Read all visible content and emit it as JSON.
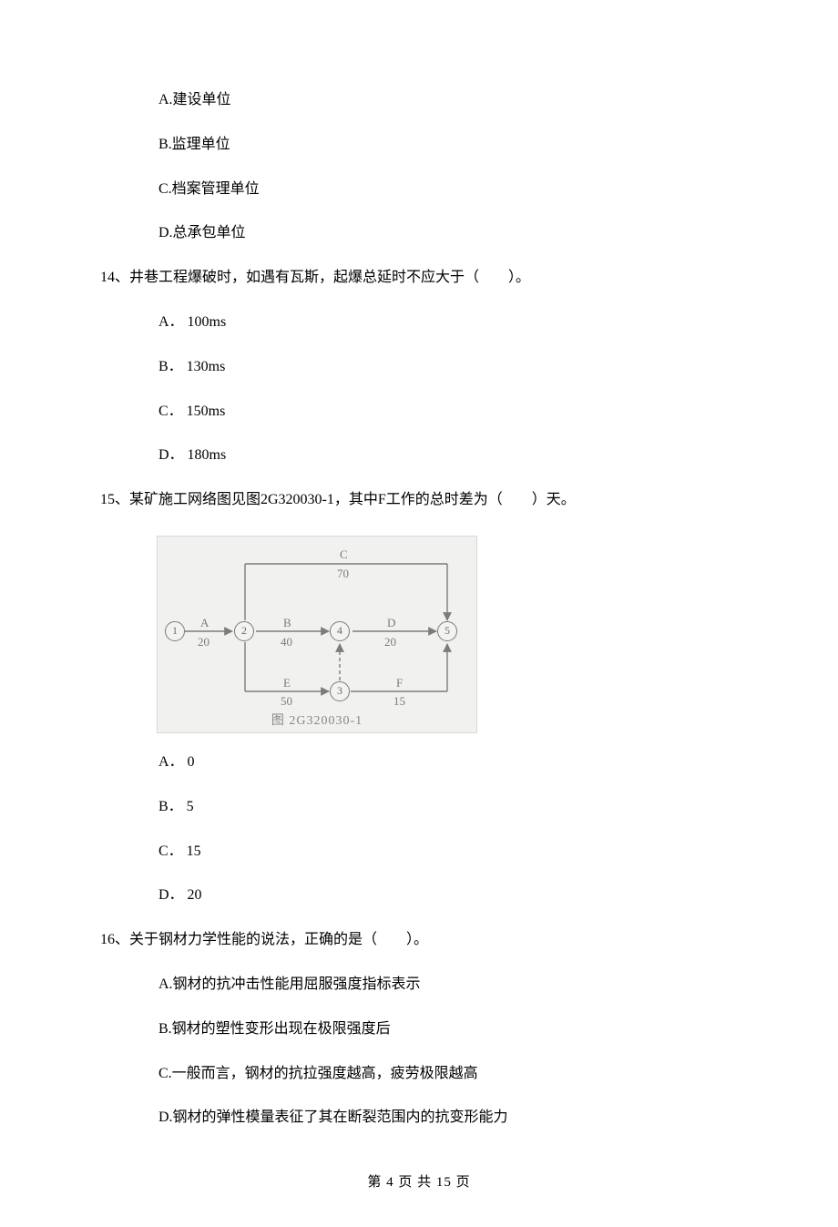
{
  "options_q13": {
    "A": "A.建设单位",
    "B": "B.监理单位",
    "C": "C.档案管理单位",
    "D": "D.总承包单位"
  },
  "q14": {
    "stem": "14、井巷工程爆破时，如遇有瓦斯，起爆总延时不应大于（　　）。",
    "options": {
      "A": "A． 100ms",
      "B": "B． 130ms",
      "C": "C． 150ms",
      "D": "D． 180ms"
    }
  },
  "q15": {
    "stem": "15、某矿施工网络图见图2G320030-1，其中F工作的总时差为（　　）天。",
    "options": {
      "A": "A． 0",
      "B": "B． 5",
      "C": "C． 15",
      "D": "D． 20"
    }
  },
  "q16": {
    "stem": "16、关于钢材力学性能的说法，正确的是（　　）。",
    "options": {
      "A": "A.钢材的抗冲击性能用屈服强度指标表示",
      "B": "B.钢材的塑性变形出现在极限强度后",
      "C": "C.一般而言，钢材的抗拉强度越高，疲劳极限越高",
      "D": "D.钢材的弹性模量表征了其在断裂范围内的抗变形能力"
    }
  },
  "network": {
    "caption": "图 2G320030-1",
    "nodes": {
      "1": "1",
      "2": "2",
      "3": "3",
      "4": "4",
      "5": "5"
    },
    "activities": {
      "A": {
        "label": "A",
        "value": "20"
      },
      "B": {
        "label": "B",
        "value": "40"
      },
      "C": {
        "label": "C",
        "value": "70"
      },
      "D": {
        "label": "D",
        "value": "20"
      },
      "E": {
        "label": "E",
        "value": "50"
      },
      "F": {
        "label": "F",
        "value": "15"
      }
    }
  },
  "footer": "第 4 页 共 15 页"
}
